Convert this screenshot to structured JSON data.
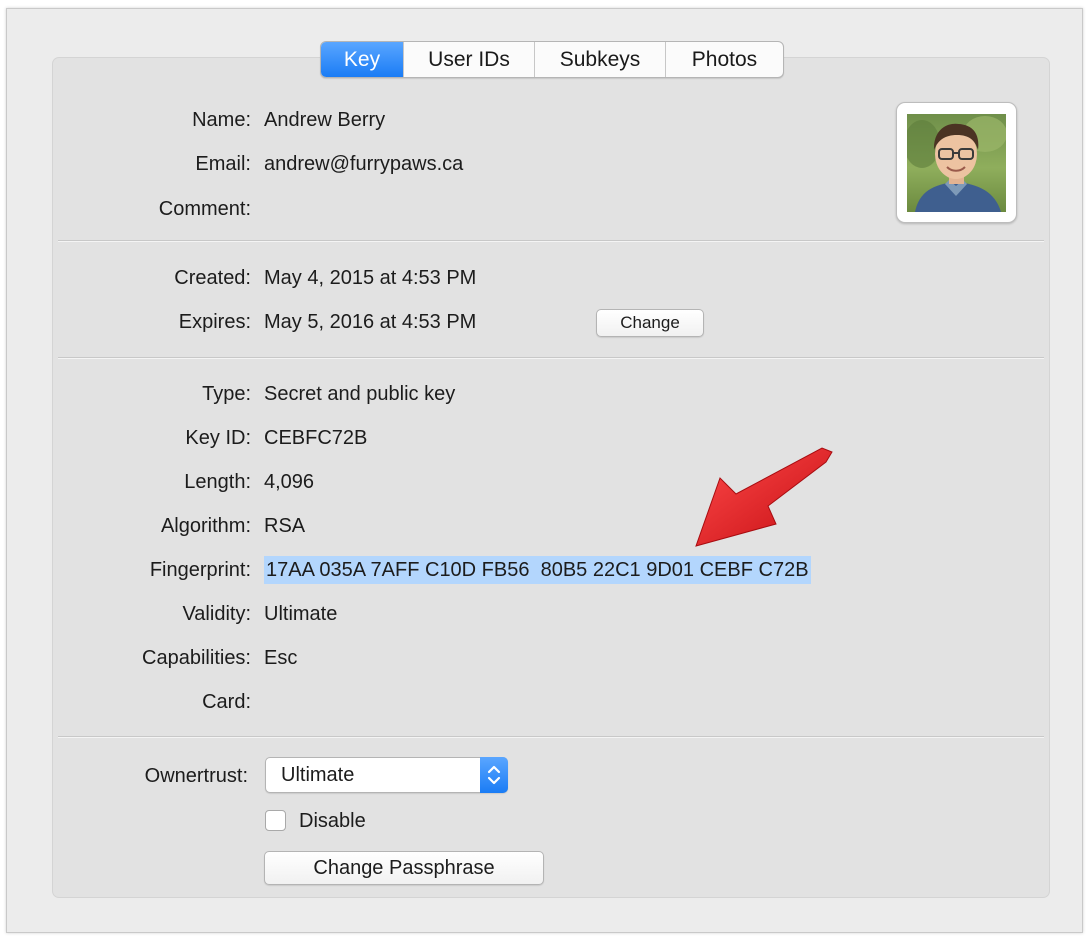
{
  "tabs": [
    {
      "label": "Key",
      "active": true
    },
    {
      "label": "User IDs",
      "active": false
    },
    {
      "label": "Subkeys",
      "active": false
    },
    {
      "label": "Photos",
      "active": false
    }
  ],
  "identity": {
    "name_label": "Name:",
    "name": "Andrew Berry",
    "email_label": "Email:",
    "email": "andrew@furrypaws.ca",
    "comment_label": "Comment:",
    "comment": ""
  },
  "dates": {
    "created_label": "Created:",
    "created": "May 4, 2015 at 4:53 PM",
    "expires_label": "Expires:",
    "expires": "May 5, 2016 at 4:53 PM",
    "change_label": "Change"
  },
  "details": {
    "type_label": "Type:",
    "type": "Secret and public key",
    "keyid_label": "Key ID:",
    "keyid": "CEBFC72B",
    "length_label": "Length:",
    "length": "4,096",
    "algorithm_label": "Algorithm:",
    "algorithm": "RSA",
    "fingerprint_label": "Fingerprint:",
    "fingerprint": "17AA 035A 7AFF C10D FB56  80B5 22C1 9D01 CEBF C72B",
    "validity_label": "Validity:",
    "validity": "Ultimate",
    "capabilities_label": "Capabilities:",
    "capabilities": "Esc",
    "card_label": "Card:",
    "card": ""
  },
  "trust": {
    "ownertrust_label": "Ownertrust:",
    "ownertrust_value": "Ultimate",
    "disable_label": "Disable",
    "disable_checked": false,
    "change_passphrase_label": "Change Passphrase"
  },
  "colors": {
    "accent": "#1a7cf5",
    "selection": "#b3d6fd",
    "annotation_arrow": "#e0161b"
  },
  "icons": {
    "photo": "user-photo",
    "stepper": "up-down-chevron-icon",
    "arrow": "red-annotation-arrow"
  }
}
